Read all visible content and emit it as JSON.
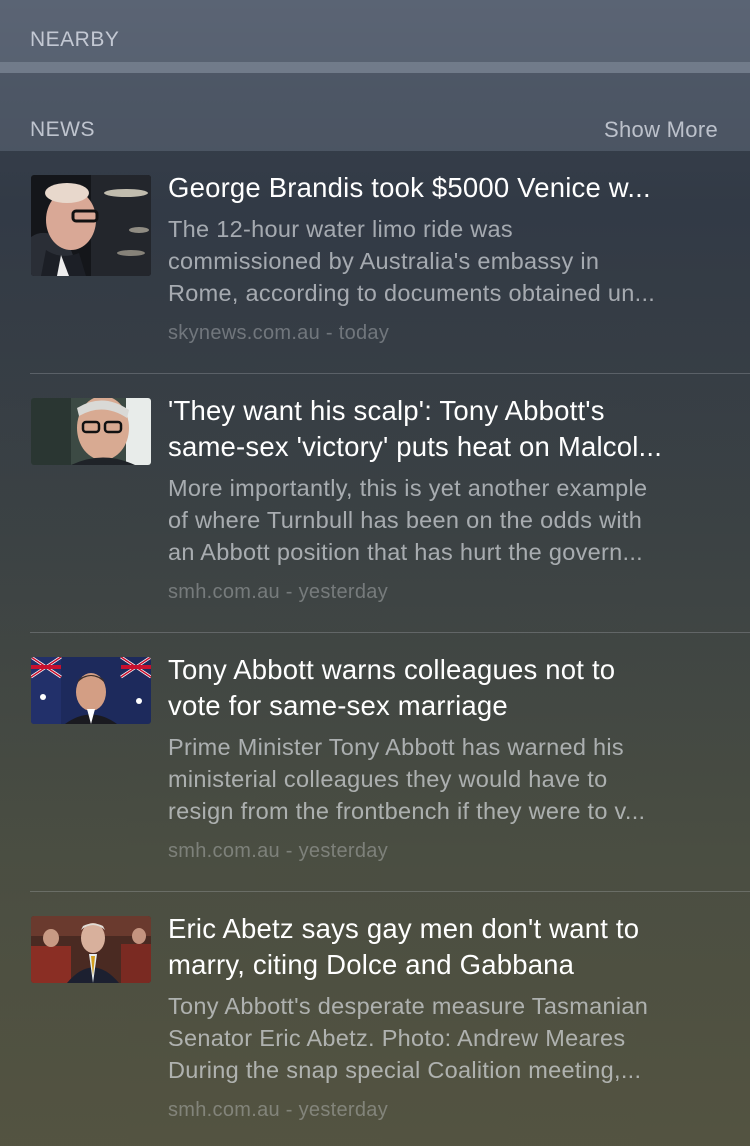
{
  "sections": {
    "nearby": {
      "label": "NEARBY"
    },
    "news": {
      "label": "NEWS",
      "show_more": "Show More"
    }
  },
  "news_items": [
    {
      "headline_lines": [
        "George Brandis took $5000 Venice w..."
      ],
      "snippet_lines": [
        "The 12-hour water limo ride was",
        "commissioned by Australia's embassy in",
        "Rome, according to documents obtained un..."
      ],
      "source": "skynews.com.au",
      "time": "today",
      "thumbnail": "brandis-photo"
    },
    {
      "headline_lines": [
        "'They want his scalp': Tony Abbott's",
        "same-sex 'victory' puts heat on Malcol..."
      ],
      "snippet_lines": [
        "More importantly, this is yet another example",
        "of where Turnbull has been on the odds with",
        "an Abbott position that has hurt the govern..."
      ],
      "source": "smh.com.au",
      "time": "yesterday",
      "thumbnail": "turnbull-photo"
    },
    {
      "headline_lines": [
        "Tony Abbott warns colleagues not to",
        "vote for same-sex marriage"
      ],
      "snippet_lines": [
        "Prime Minister Tony Abbott has warned his",
        "ministerial colleagues they would have to",
        "resign from the frontbench if they were to v..."
      ],
      "source": "smh.com.au",
      "time": "yesterday",
      "thumbnail": "abbott-flags-photo"
    },
    {
      "headline_lines": [
        "Eric Abetz says gay men don't want to",
        "marry, citing Dolce and Gabbana"
      ],
      "snippet_lines": [
        "Tony Abbott's desperate measure Tasmanian",
        "Senator Eric Abetz. Photo: Andrew Meares",
        "During the snap special Coalition meeting,..."
      ],
      "source": "smh.com.au",
      "time": "yesterday",
      "thumbnail": "abetz-senate-photo"
    }
  ],
  "meta_separator": " - "
}
